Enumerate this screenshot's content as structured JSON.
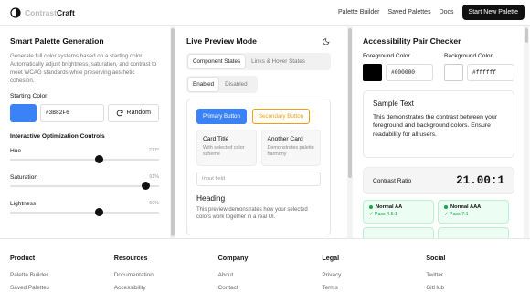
{
  "header": {
    "logo_text": "ContrastCraft",
    "nav": [
      "Palette Builder",
      "Saved Palettes",
      "Docs"
    ],
    "cta_label": "Start New Palette"
  },
  "generator": {
    "title": "Smart Palette Generation",
    "description": "Generate full color systems based on a starting color. Automatically adjust brightness, saturation, and contrast to meet WCAG standards while preserving aesthetic cohesion.",
    "starting_color_label": "Starting Color",
    "starting_color": "#3B82F6",
    "starting_color_display": "#3B82F6",
    "random_label": "Random",
    "controls_title": "Interactive Optimization Controls",
    "sliders": [
      {
        "label": "Hue",
        "value_text": "217°",
        "fraction": 0.6
      },
      {
        "label": "Saturation",
        "value_text": "91%",
        "fraction": 0.91
      },
      {
        "label": "Lightness",
        "value_text": "60%",
        "fraction": 0.6
      }
    ]
  },
  "preview": {
    "title": "Live Preview Mode",
    "mode_icon": "moon-icon",
    "tabs": [
      "Component States",
      "Links & Hover States"
    ],
    "state_tabs": [
      "Enabled",
      "Disabled"
    ],
    "primary_button": "Primary Button",
    "secondary_button": "Secondary Button",
    "cards": [
      {
        "title": "Card Title",
        "text": "With selected color scheme"
      },
      {
        "title": "Another Card",
        "text": "Demonstrates palette harmony"
      }
    ],
    "input_placeholder": "Input field",
    "heading": "Heading",
    "paragraph": "This preview demonstrates how your selected colors work together in a real UI."
  },
  "checker": {
    "title": "Accessibility Pair Checker",
    "foreground_label": "Foreground Color",
    "foreground": "#000000",
    "background_label": "Background Color",
    "background": "#ffffff",
    "sample_title": "Sample Text",
    "sample_text": "This demonstrates the contrast between your foreground and background colors. Ensure readability for all users.",
    "ratio_label": "Contrast Ratio",
    "ratio_value": "21.00:1",
    "badges": [
      {
        "title": "Normal AA",
        "sub": "✓ Pass 4.5:1"
      },
      {
        "title": "Normal AAA",
        "sub": "✓ Pass 7:1"
      }
    ]
  },
  "footer": {
    "columns": [
      {
        "heading": "Product",
        "links": [
          "Palette Builder",
          "Saved Palettes"
        ]
      },
      {
        "heading": "Resources",
        "links": [
          "Documentation",
          "Accessibility"
        ]
      },
      {
        "heading": "Company",
        "links": [
          "About",
          "Contact"
        ]
      },
      {
        "heading": "Legal",
        "links": [
          "Privacy",
          "Terms"
        ]
      },
      {
        "heading": "Social",
        "links": [
          "Twitter",
          "GitHub"
        ]
      }
    ]
  }
}
